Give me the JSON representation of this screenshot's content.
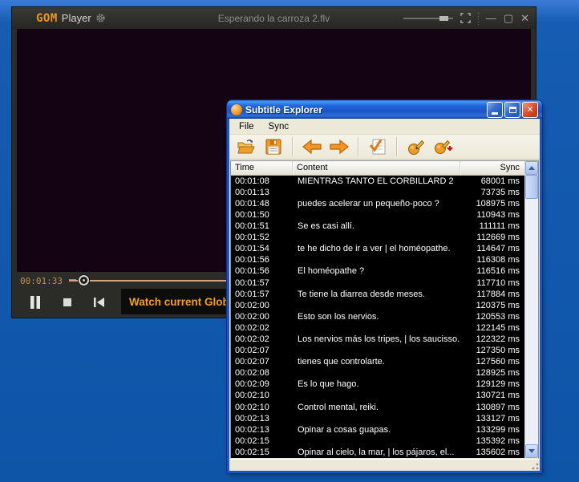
{
  "colors": {
    "gom_accent_orange": "#ef9420",
    "banner_text_orange": "#f3a11c",
    "xp_titlebar_blue": "#1a55c8",
    "desktop_blue": "#0e55a8",
    "list_bg": "#000000",
    "list_text": "#ffffff"
  },
  "gom_player": {
    "logo_gom": "GOM",
    "logo_player": "Player",
    "window_title": "Esperando la carroza 2.flv",
    "current_time": "00:01:33",
    "banner_text": "Watch current Global S"
  },
  "subtitle_explorer": {
    "window_title": "Subtitle Explorer",
    "menu": [
      {
        "label": "File"
      },
      {
        "label": "Sync"
      }
    ],
    "toolbar_icons": [
      "open-icon",
      "save-icon",
      "prev-arrow-icon",
      "next-arrow-icon",
      "apply-check-icon",
      "sync-edit-icon",
      "sync-shift-icon"
    ],
    "table": {
      "columns": {
        "time": "Time",
        "content": "Content",
        "sync": "Sync"
      },
      "rows": [
        {
          "time": "00:01:08",
          "content": "MIENTRAS TANTO EL CORBILLARD 2",
          "sync": "68001 ms"
        },
        {
          "time": "00:01:13",
          "content": "",
          "sync": "73735 ms"
        },
        {
          "time": "00:01:48",
          "content": "puedes acelerar un pequeño-poco ?",
          "sync": "108975 ms"
        },
        {
          "time": "00:01:50",
          "content": "",
          "sync": "110943 ms"
        },
        {
          "time": "00:01:51",
          "content": "Se es casi allí.",
          "sync": "111111 ms"
        },
        {
          "time": "00:01:52",
          "content": "",
          "sync": "112669 ms"
        },
        {
          "time": "00:01:54",
          "content": "te he dicho de ir a ver | el homéopathe.",
          "sync": "114647 ms"
        },
        {
          "time": "00:01:56",
          "content": "",
          "sync": "116308 ms"
        },
        {
          "time": "00:01:56",
          "content": "El homéopathe ?",
          "sync": "116516 ms"
        },
        {
          "time": "00:01:57",
          "content": "",
          "sync": "117710 ms"
        },
        {
          "time": "00:01:57",
          "content": "Te tiene la diarrea desde meses.",
          "sync": "117884 ms"
        },
        {
          "time": "00:02:00",
          "content": "",
          "sync": "120375 ms"
        },
        {
          "time": "00:02:00",
          "content": "Esto son los nervios.",
          "sync": "120553 ms"
        },
        {
          "time": "00:02:02",
          "content": "",
          "sync": "122145 ms"
        },
        {
          "time": "00:02:02",
          "content": "Los nervios más los tripes, | los saucisso...",
          "sync": "122322 ms"
        },
        {
          "time": "00:02:07",
          "content": "",
          "sync": "127350 ms"
        },
        {
          "time": "00:02:07",
          "content": "tienes que controlarte.",
          "sync": "127560 ms"
        },
        {
          "time": "00:02:08",
          "content": "",
          "sync": "128925 ms"
        },
        {
          "time": "00:02:09",
          "content": "Es lo que hago.",
          "sync": "129129 ms"
        },
        {
          "time": "00:02:10",
          "content": "",
          "sync": "130721 ms"
        },
        {
          "time": "00:02:10",
          "content": "Control mental, reiki.",
          "sync": "130897 ms"
        },
        {
          "time": "00:02:13",
          "content": "",
          "sync": "133127 ms"
        },
        {
          "time": "00:02:13",
          "content": "Opinar a cosas guapas.",
          "sync": "133299 ms"
        },
        {
          "time": "00:02:15",
          "content": "",
          "sync": "135392 ms"
        },
        {
          "time": "00:02:15",
          "content": "Opinar al cielo, la mar, | los pájaros, el...",
          "sync": "135602 ms"
        }
      ]
    }
  }
}
